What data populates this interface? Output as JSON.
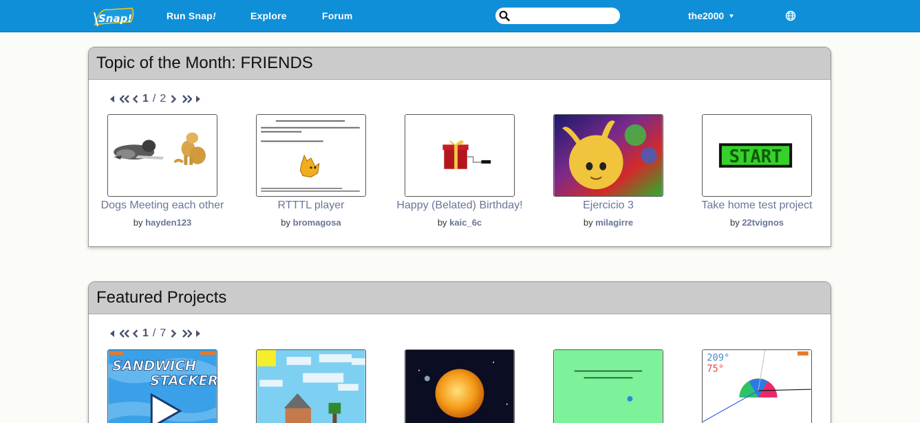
{
  "nav": {
    "logo_text": "Snap!",
    "run_label": "Run Snap",
    "run_suffix": "!",
    "explore_label": "Explore",
    "forum_label": "Forum",
    "search_placeholder": "",
    "username": "the2000"
  },
  "sections": [
    {
      "title": "Topic of the Month: FRIENDS",
      "page_current": "1",
      "page_separator": "/",
      "page_total": "2",
      "projects": [
        {
          "title": "Dogs Meeting each other",
          "by": "by",
          "author": "hayden123"
        },
        {
          "title": "RTTTL player",
          "by": "by",
          "author": "bromagosa"
        },
        {
          "title": "Happy (Belated) Birthday!",
          "by": "by",
          "author": "kaic_6c"
        },
        {
          "title": "Ejercicio 3",
          "by": "by",
          "author": "milagirre"
        },
        {
          "title": "Take home test project",
          "by": "by",
          "author": "22tvignos"
        }
      ]
    },
    {
      "title": "Featured Projects",
      "page_current": "1",
      "page_separator": "/",
      "page_total": "7",
      "thumb_texts": {
        "sandwich_line1": "SANDWICH",
        "sandwich_line2": "STACKER",
        "start": "START",
        "angle1": "209°",
        "angle2": "75°"
      }
    }
  ],
  "colors": {
    "nav_bg": "#0f8fd8",
    "page_bg": "#fbfcf7",
    "panel_header_bg": "#cbcbcb",
    "link": "#6a7499"
  }
}
